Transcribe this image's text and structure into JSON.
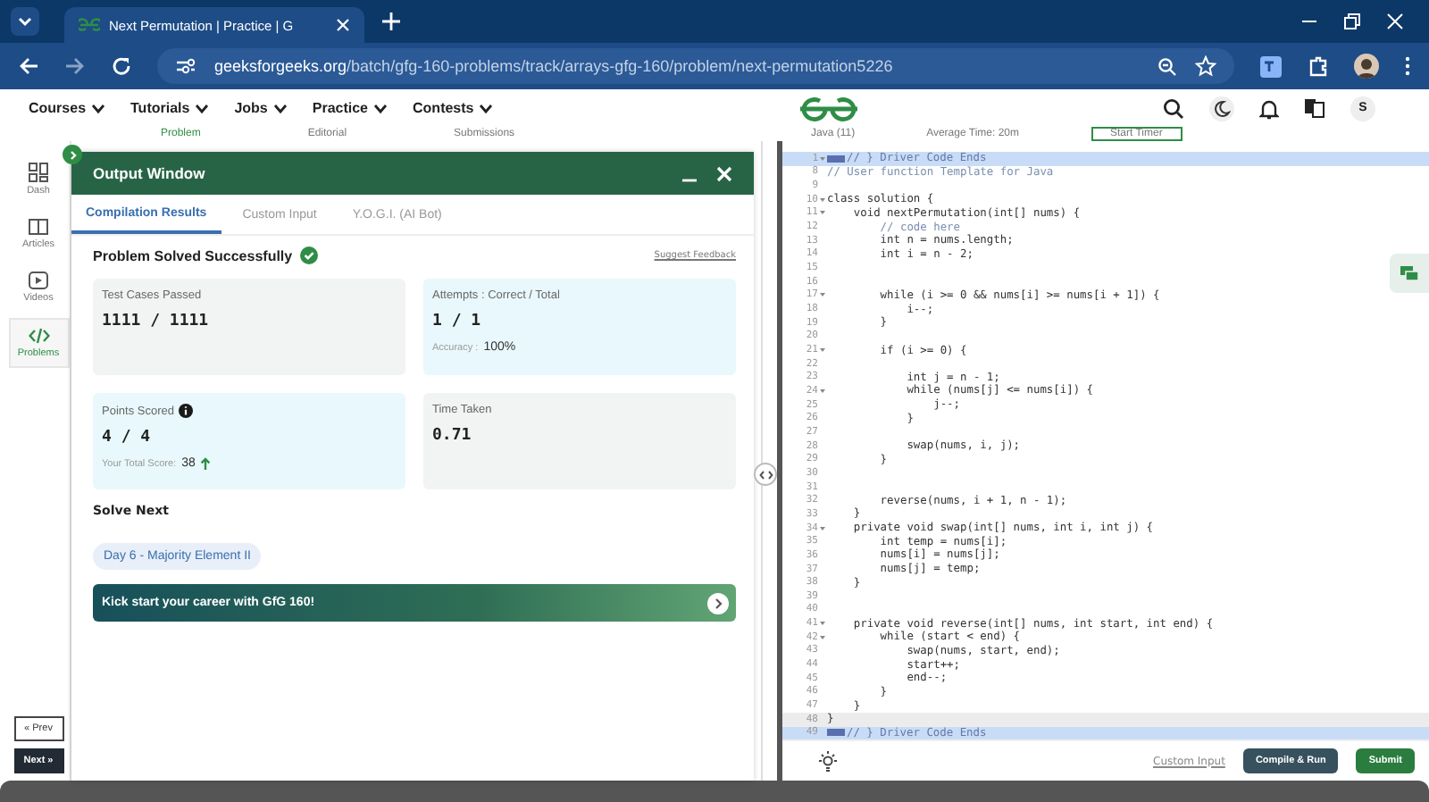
{
  "browser": {
    "tab_title": "Next Permutation | Practice | G",
    "url_domain": "geeksforgeeks.org",
    "url_path": "/batch/gfg-160-problems/track/arrays-gfg-160/problem/next-permutation5226"
  },
  "site_nav": {
    "items": [
      "Courses",
      "Tutorials",
      "Jobs",
      "Practice",
      "Contests"
    ],
    "user_initial": "S"
  },
  "problem_tabs": [
    {
      "label": "Problem",
      "selected": true
    },
    {
      "label": "Editorial",
      "selected": false
    },
    {
      "label": "Submissions",
      "selected": false
    }
  ],
  "editor_bar": {
    "language": "Java (11)",
    "average_time": "Average Time: 20m",
    "timer_button": "Start Timer"
  },
  "sidebar": {
    "items": [
      {
        "label": "Dash",
        "kind": "dash",
        "selected": false
      },
      {
        "label": "Articles",
        "kind": "articles",
        "selected": false
      },
      {
        "label": "Videos",
        "kind": "videos",
        "selected": false
      },
      {
        "label": "Problems",
        "kind": "problems",
        "selected": true
      }
    ],
    "prev": "« Prev",
    "next": "Next »"
  },
  "output_window": {
    "title": "Output Window",
    "tabs": [
      {
        "label": "Compilation Results",
        "selected": true
      },
      {
        "label": "Custom Input",
        "selected": false
      },
      {
        "label": "Y.O.G.I. (AI Bot)",
        "selected": false
      }
    ],
    "status": "Problem Solved Successfully",
    "feedback_link": "Suggest Feedback",
    "cards": [
      {
        "label": "Test Cases Passed",
        "value": "1111 / 1111",
        "color": "#f2f4f3"
      },
      {
        "label": "Attempts : Correct / Total",
        "value": "1 / 1",
        "note_label": "Accuracy :",
        "note_value": "100%",
        "color": "#e9f8fc"
      },
      {
        "label": "Points Scored",
        "value": "4 / 4",
        "info": true,
        "note_label": "Your Total Score:",
        "note_value": "38",
        "trend_up": true,
        "color": "#e9f8fc"
      },
      {
        "label": "Time Taken",
        "value": "0.71",
        "color": "#f2f4f3"
      }
    ],
    "solve_next_heading": "Solve Next",
    "next_chip": "Day 6 - Majority Element II",
    "banner": "Kick start your career with GfG 160!"
  },
  "code": [
    {
      "n": "1",
      "text": "// } Driver Code Ends",
      "kind": "comment",
      "fold": true,
      "marker": true,
      "selected": true,
      "current": false
    },
    {
      "n": "8",
      "text": "// User function Template for Java",
      "kind": "comment",
      "fold": false,
      "marker": false,
      "selected": false,
      "current": false
    },
    {
      "n": "9",
      "fold": false,
      "marker": false,
      "selected": false,
      "current": false
    },
    {
      "n": "10",
      "text": "class solution {",
      "kind": "code",
      "fold": true,
      "marker": false,
      "selected": false,
      "current": false
    },
    {
      "n": "11",
      "text": "    void nextPermutation(int[] nums) {",
      "kind": "code",
      "fold": true,
      "marker": false,
      "selected": false,
      "current": false
    },
    {
      "n": "12",
      "text": "        // code here",
      "kind": "comment",
      "fold": false,
      "marker": false,
      "selected": false,
      "current": false
    },
    {
      "n": "13",
      "text": "        int n = nums.length;",
      "kind": "code",
      "fold": false,
      "marker": false,
      "selected": false,
      "current": false
    },
    {
      "n": "14",
      "text": "        int i = n - 2;",
      "kind": "code",
      "fold": false,
      "marker": false,
      "selected": false,
      "current": false
    },
    {
      "n": "15",
      "fold": false,
      "marker": false,
      "selected": false,
      "current": false
    },
    {
      "n": "16",
      "fold": false,
      "marker": false,
      "selected": false,
      "current": false
    },
    {
      "n": "17",
      "text": "        while (i >= 0 && nums[i] >= nums[i + 1]) {",
      "kind": "code",
      "fold": true,
      "marker": false,
      "selected": false,
      "current": false
    },
    {
      "n": "18",
      "text": "            i--;",
      "kind": "code",
      "fold": false,
      "marker": false,
      "selected": false,
      "current": false
    },
    {
      "n": "19",
      "text": "        }",
      "kind": "code",
      "fold": false,
      "marker": false,
      "selected": false,
      "current": false
    },
    {
      "n": "20",
      "fold": false,
      "marker": false,
      "selected": false,
      "current": false
    },
    {
      "n": "21",
      "text": "        if (i >= 0) {",
      "kind": "code",
      "fold": true,
      "marker": false,
      "selected": false,
      "current": false
    },
    {
      "n": "22",
      "fold": false,
      "marker": false,
      "selected": false,
      "current": false
    },
    {
      "n": "23",
      "text": "            int j = n - 1;",
      "kind": "code",
      "fold": false,
      "marker": false,
      "selected": false,
      "current": false
    },
    {
      "n": "24",
      "text": "            while (nums[j] <= nums[i]) {",
      "kind": "code",
      "fold": true,
      "marker": false,
      "selected": false,
      "current": false
    },
    {
      "n": "25",
      "text": "                j--;",
      "kind": "code",
      "fold": false,
      "marker": false,
      "selected": false,
      "current": false
    },
    {
      "n": "26",
      "text": "            }",
      "kind": "code",
      "fold": false,
      "marker": false,
      "selected": false,
      "current": false
    },
    {
      "n": "27",
      "fold": false,
      "marker": false,
      "selected": false,
      "current": false
    },
    {
      "n": "28",
      "text": "            swap(nums, i, j);",
      "kind": "code",
      "fold": false,
      "marker": false,
      "selected": false,
      "current": false
    },
    {
      "n": "29",
      "text": "        }",
      "kind": "code",
      "fold": false,
      "marker": false,
      "selected": false,
      "current": false
    },
    {
      "n": "30",
      "fold": false,
      "marker": false,
      "selected": false,
      "current": false
    },
    {
      "n": "31",
      "fold": false,
      "marker": false,
      "selected": false,
      "current": false
    },
    {
      "n": "32",
      "text": "        reverse(nums, i + 1, n - 1);",
      "kind": "code",
      "fold": false,
      "marker": false,
      "selected": false,
      "current": false
    },
    {
      "n": "33",
      "text": "    }",
      "kind": "code",
      "fold": false,
      "marker": false,
      "selected": false,
      "current": false
    },
    {
      "n": "34",
      "text": "    private void swap(int[] nums, int i, int j) {",
      "kind": "code",
      "fold": true,
      "marker": false,
      "selected": false,
      "current": false
    },
    {
      "n": "35",
      "text": "        int temp = nums[i];",
      "kind": "code",
      "fold": false,
      "marker": false,
      "selected": false,
      "current": false
    },
    {
      "n": "36",
      "text": "        nums[i] = nums[j];",
      "kind": "code",
      "fold": false,
      "marker": false,
      "selected": false,
      "current": false
    },
    {
      "n": "37",
      "text": "        nums[j] = temp;",
      "kind": "code",
      "fold": false,
      "marker": false,
      "selected": false,
      "current": false
    },
    {
      "n": "38",
      "text": "    }",
      "kind": "code",
      "fold": false,
      "marker": false,
      "selected": false,
      "current": false
    },
    {
      "n": "39",
      "fold": false,
      "marker": false,
      "selected": false,
      "current": false
    },
    {
      "n": "40",
      "fold": false,
      "marker": false,
      "selected": false,
      "current": false
    },
    {
      "n": "41",
      "text": "    private void reverse(int[] nums, int start, int end) {",
      "kind": "code",
      "fold": true,
      "marker": false,
      "selected": false,
      "current": false
    },
    {
      "n": "42",
      "text": "        while (start < end) {",
      "kind": "code",
      "fold": true,
      "marker": false,
      "selected": false,
      "current": false
    },
    {
      "n": "43",
      "text": "            swap(nums, start, end);",
      "kind": "code",
      "fold": false,
      "marker": false,
      "selected": false,
      "current": false
    },
    {
      "n": "44",
      "text": "            start++;",
      "kind": "code",
      "fold": false,
      "marker": false,
      "selected": false,
      "current": false
    },
    {
      "n": "45",
      "text": "            end--;",
      "kind": "code",
      "fold": false,
      "marker": false,
      "selected": false,
      "current": false
    },
    {
      "n": "46",
      "text": "        }",
      "kind": "code",
      "fold": false,
      "marker": false,
      "selected": false,
      "current": false
    },
    {
      "n": "47",
      "text": "    }",
      "kind": "code",
      "fold": false,
      "marker": false,
      "selected": false,
      "current": false
    },
    {
      "n": "48",
      "text": "}",
      "kind": "code",
      "fold": false,
      "marker": false,
      "selected": false,
      "current": true
    },
    {
      "n": "49",
      "text": "// } Driver Code Ends",
      "kind": "comment",
      "fold": false,
      "marker": true,
      "selected": true,
      "current": false
    }
  ],
  "editor_footer": {
    "custom_input": "Custom Input",
    "compile_button": "Compile & Run",
    "submit_button": "Submit"
  }
}
